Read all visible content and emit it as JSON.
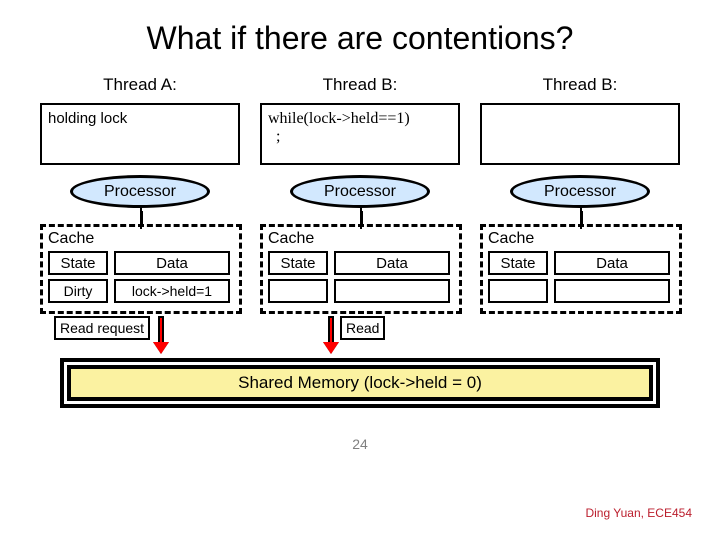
{
  "title": "What if there are contentions?",
  "threads": [
    {
      "label": "Thread A:",
      "code": "holding lock",
      "roman": false
    },
    {
      "label": "Thread B:",
      "code": "while(lock->held==1)\n  ;",
      "roman": true
    },
    {
      "label": "Thread B:",
      "code": "",
      "roman": true
    }
  ],
  "processor_label": "Processor",
  "cache_label": "Cache",
  "state_header": "State",
  "data_header": "Data",
  "caches": [
    {
      "state": "Dirty",
      "data": "lock->held=1"
    },
    {
      "state": "",
      "data": ""
    },
    {
      "state": "",
      "data": ""
    }
  ],
  "read_request": "Read request",
  "read": "Read",
  "memory": "Shared Memory (lock->held = 0)",
  "pagenum": "24",
  "credit": "Ding Yuan, ECE454"
}
